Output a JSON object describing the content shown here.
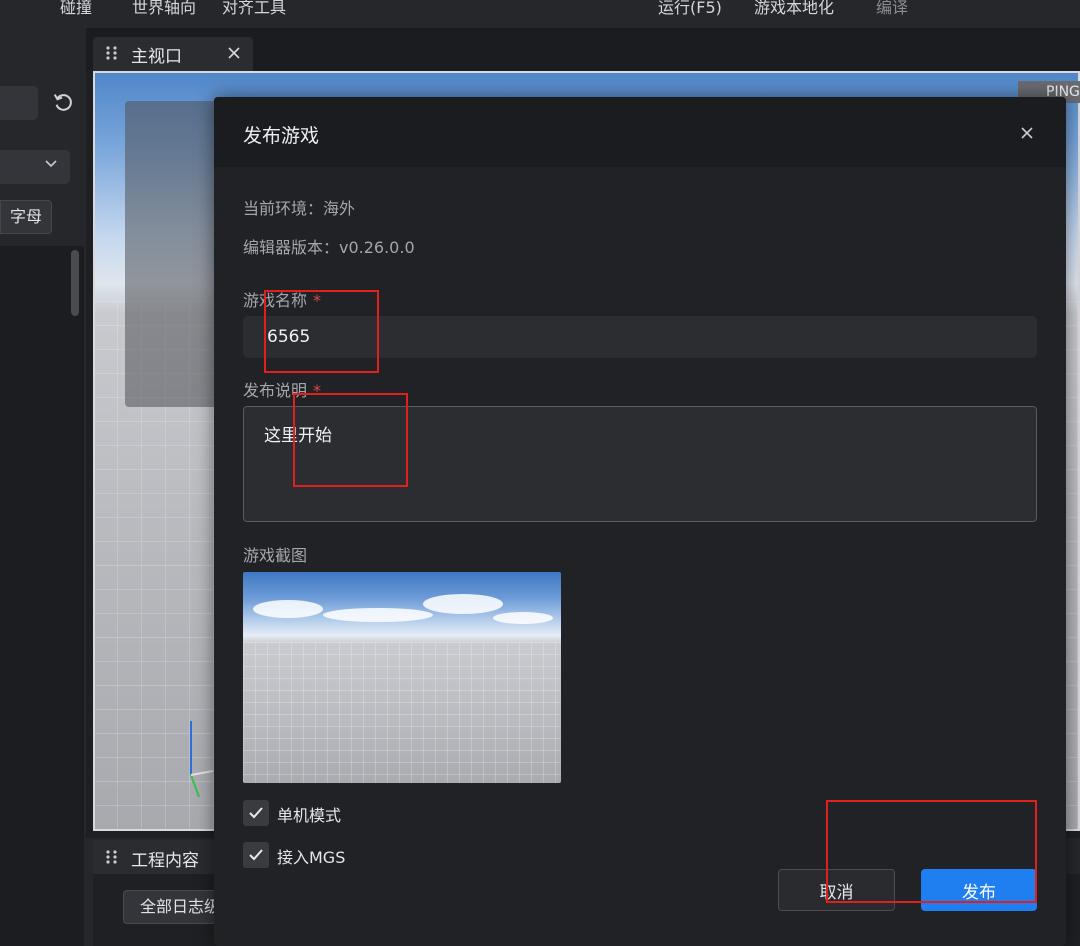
{
  "menubar": {
    "items": [
      "碰撞",
      "世界轴向",
      "对齐工具",
      "运行(F5)",
      "游戏本地化",
      "编译"
    ]
  },
  "left_panel": {
    "letter_button": "字母"
  },
  "viewport": {
    "tab_title": "主视口",
    "ping_label": "PING"
  },
  "project_panel": {
    "tab_title": "工程内容",
    "log_button": "全部日志级"
  },
  "publish_dialog": {
    "title": "发布游戏",
    "environment": "当前环境：海外",
    "editor_version": "编辑器版本：v0.26.0.0",
    "name_label": "游戏名称",
    "name_value": "6565",
    "desc_label": "发布说明",
    "desc_value": "这里开始",
    "required_mark": "*",
    "screenshot_label": "游戏截图",
    "single_player_label": "单机模式",
    "single_player_checked": true,
    "mgs_label": "接入MGS",
    "mgs_checked": true,
    "cancel_label": "取消",
    "publish_label": "发布"
  },
  "colors": {
    "accent": "#1f7ef0",
    "required": "#e04646",
    "annotation": "#e0201c"
  },
  "icons": [
    "refresh-icon",
    "chevron-down-icon",
    "grip-icon",
    "close-icon",
    "check-icon",
    "axis-gizmo-icon"
  ]
}
